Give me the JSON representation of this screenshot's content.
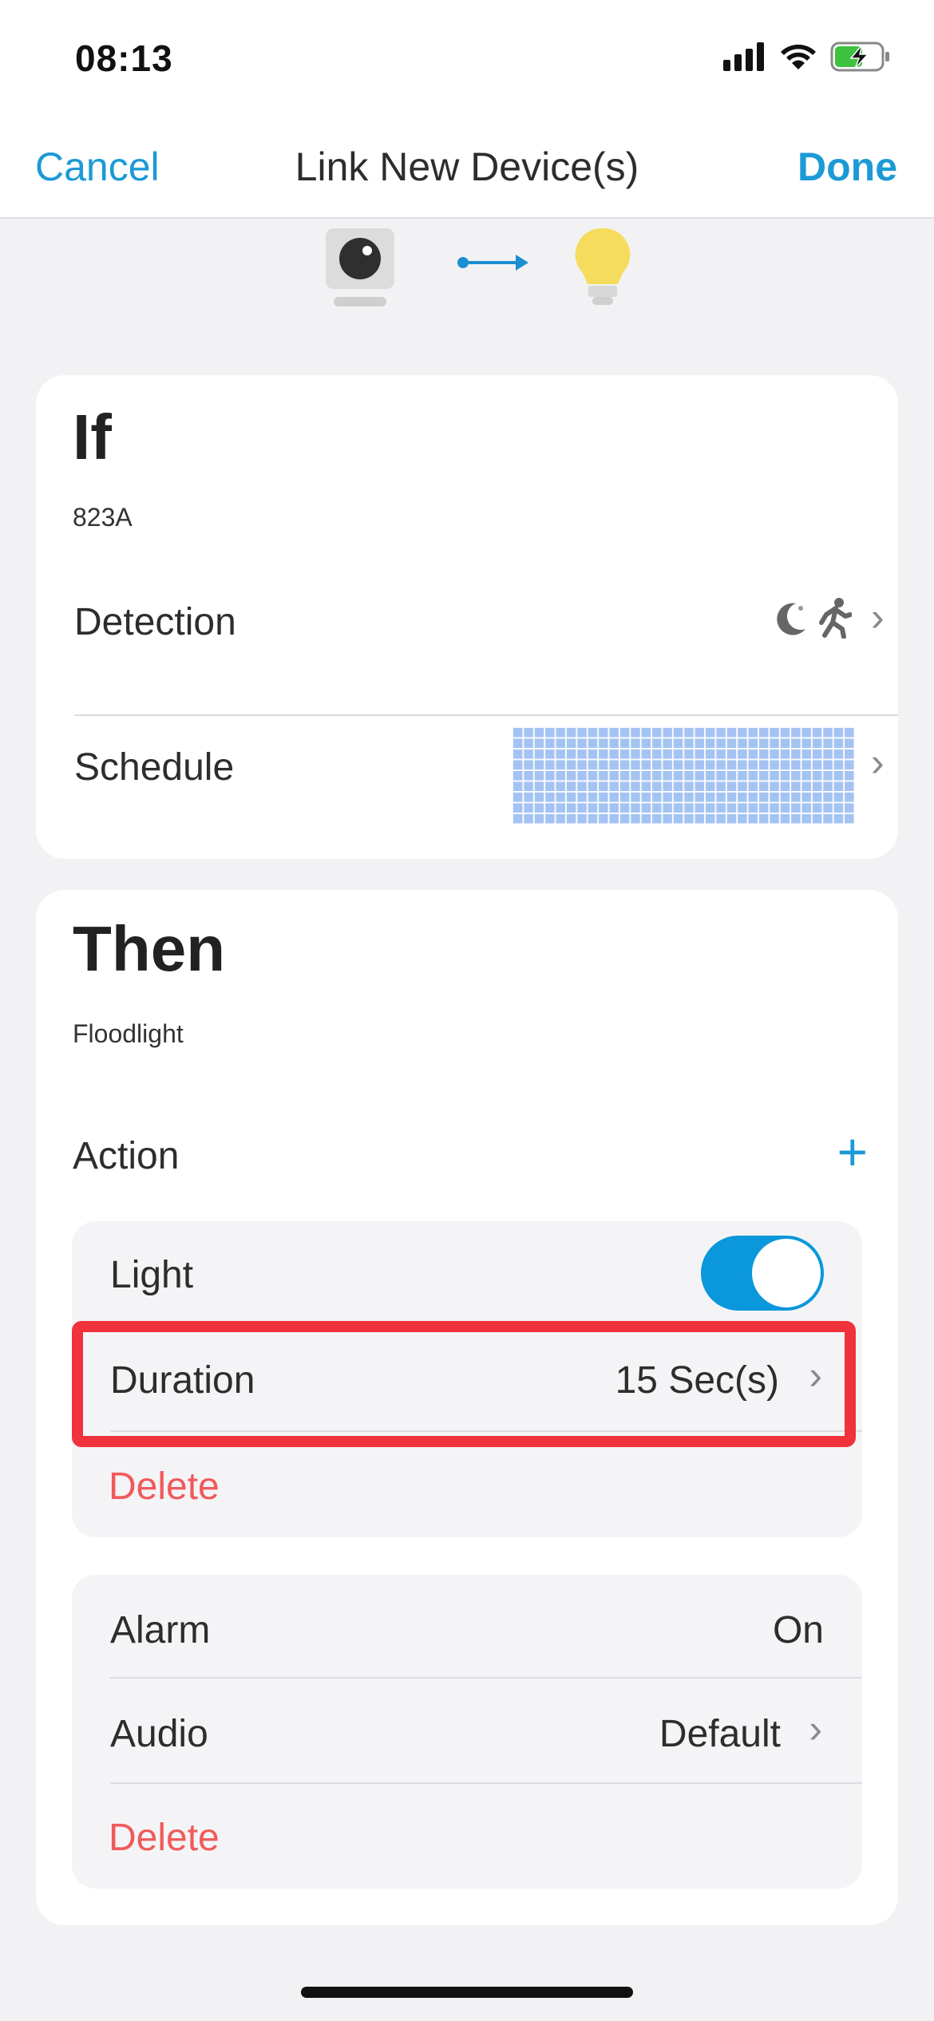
{
  "status_bar": {
    "time": "08:13",
    "icons": [
      "cellular-signal-icon",
      "wifi-icon",
      "battery-charging-icon"
    ]
  },
  "nav": {
    "cancel_label": "Cancel",
    "title": "Link New Device(s)",
    "done_label": "Done"
  },
  "link_visual": {
    "source_icon": "camera-icon",
    "arrow_icon": "arrow-right-icon",
    "target_icon": "lightbulb-icon"
  },
  "if_card": {
    "heading": "If",
    "device": "823A",
    "rows": [
      {
        "label": "Detection",
        "icons": [
          "night-vision-icon",
          "motion-person-icon"
        ]
      },
      {
        "label": "Schedule"
      }
    ]
  },
  "then_card": {
    "heading": "Then",
    "device": "Floodlight",
    "action_label": "Action",
    "add_icon": "plus-icon",
    "light_group": {
      "label": "Light",
      "toggle_on": true,
      "duration_label": "Duration",
      "duration_value": "15 Sec(s)",
      "delete_label": "Delete"
    },
    "alarm_group": {
      "alarm_label": "Alarm",
      "alarm_value": "On",
      "audio_label": "Audio",
      "audio_value": "Default",
      "delete_label": "Delete"
    }
  },
  "colors": {
    "accent": "#1c9ad6",
    "delete": "#f05a5a",
    "highlight": "#f0323c",
    "toggle": "#0a97dc",
    "schedule": "#a4c3f2",
    "bulb": "#f5dc5c"
  }
}
